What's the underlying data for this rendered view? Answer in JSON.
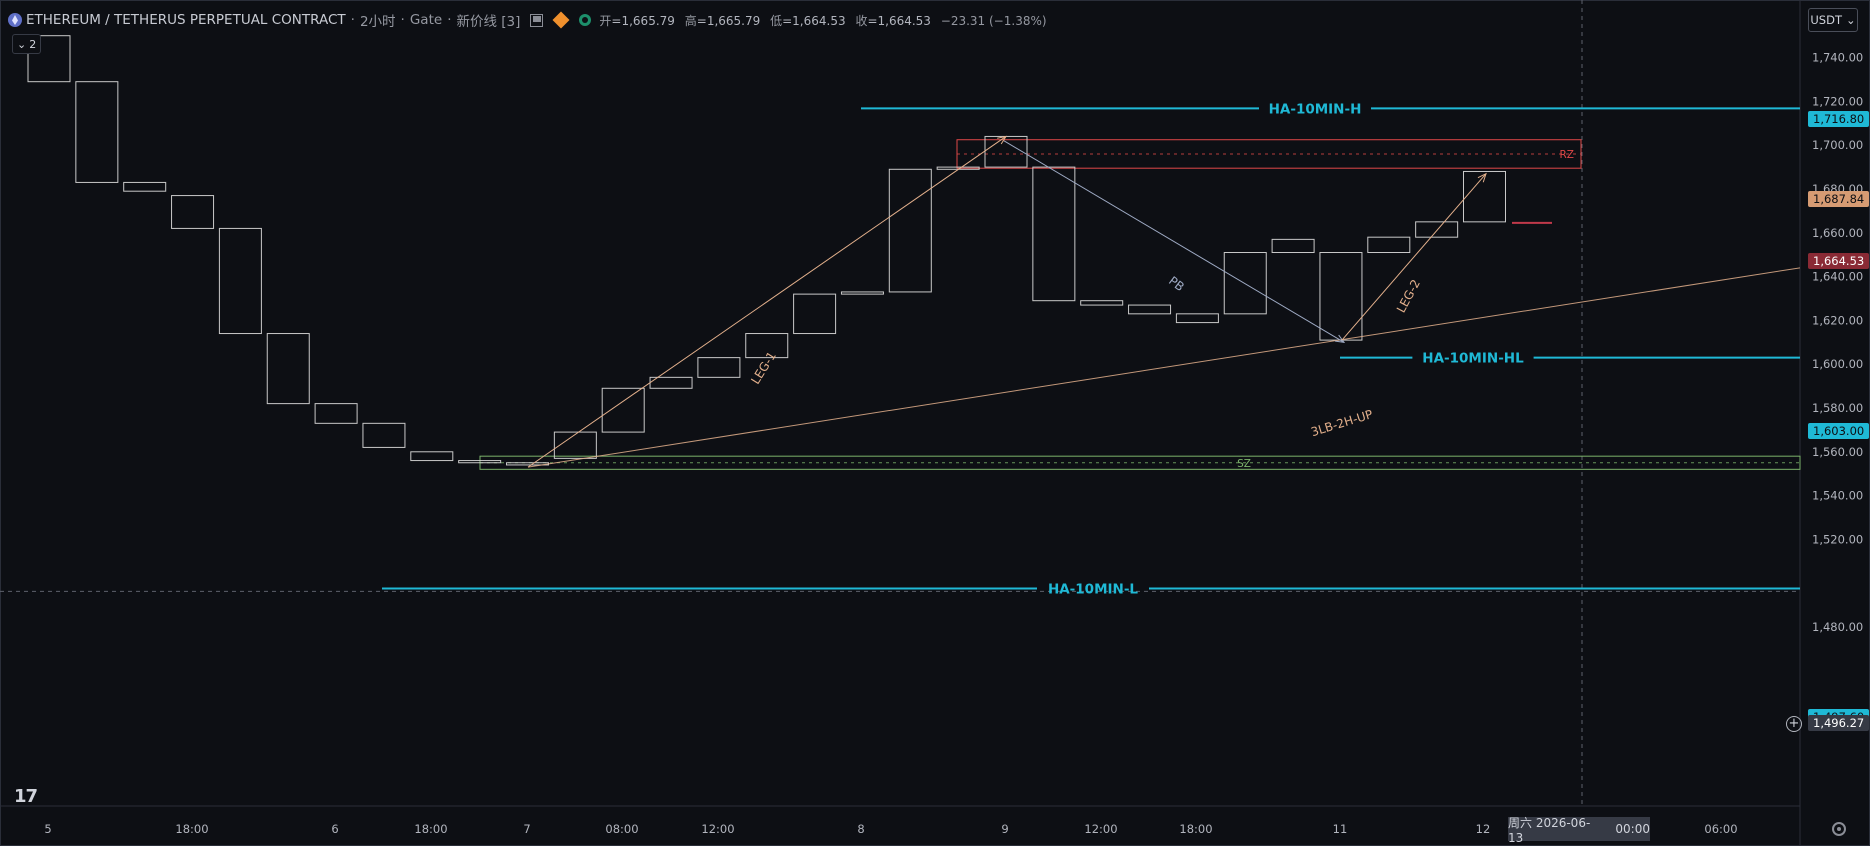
{
  "header": {
    "symbol": "ETHEREUM / TETHERUS PERPETUAL CONTRACT",
    "interval": "2小时",
    "exchange": "Gate",
    "style": "新价线 [3]",
    "open_label": "开",
    "open": "=1,665.79",
    "high_label": "高",
    "high": "=1,665.79",
    "low_label": "低",
    "low": "=1,664.53",
    "close_label": "收",
    "close": "=1,664.53",
    "change": "−23.31 (−1.38%)",
    "icons": [
      "ethereum-icon",
      "flag-icon",
      "diamond-icon",
      "market-status-icon"
    ]
  },
  "legend_button": {
    "label": "2"
  },
  "currency_button": {
    "label": "USDT"
  },
  "crosshair_datetime": {
    "date": "周六 2026-06-13",
    "time": "00:00"
  },
  "colors": {
    "background": "#0d0f14",
    "candle": "#d9d9d9",
    "leg_color": "#e3b08c",
    "pb_color": "#9eaac4",
    "ha_line": "#1fb9d6",
    "rz": "#e04848",
    "sz": "#7cb36b",
    "last_price_tag": "#8a2a35",
    "orange_tag": "#d69b73"
  },
  "chart_data": {
    "type": "line",
    "subtype": "renko_line_break",
    "ylim": [
      1465,
      1750
    ],
    "y_ticks": [
      "1,740.00",
      "1,720.00",
      "1,700.00",
      "1,680.00",
      "1,660.00",
      "1,640.00",
      "1,620.00",
      "1,600.00",
      "1,580.00",
      "1,560.00",
      "1,540.00",
      "1,520.00",
      "1,480.00"
    ],
    "x_ticks": [
      "5",
      "18:00",
      "6",
      "18:00",
      "7",
      "08:00",
      "12:00",
      "8",
      "9",
      "12:00",
      "18:00",
      "11",
      "12",
      "06:00"
    ],
    "bricks": [
      [
        1750,
        1729
      ],
      [
        1729,
        1683
      ],
      [
        1683,
        1679
      ],
      [
        1677,
        1662
      ],
      [
        1662,
        1614
      ],
      [
        1614,
        1582
      ],
      [
        1582,
        1573
      ],
      [
        1573,
        1562
      ],
      [
        1560,
        1556
      ],
      [
        1556,
        1555
      ],
      [
        1555,
        1554
      ],
      [
        1557,
        1569
      ],
      [
        1569,
        1589
      ],
      [
        1589,
        1594
      ],
      [
        1594,
        1603
      ],
      [
        1603,
        1614
      ],
      [
        1614,
        1632
      ],
      [
        1632,
        1633
      ],
      [
        1633,
        1689
      ],
      [
        1689,
        1690
      ],
      [
        1690,
        1704
      ],
      [
        1690,
        1629
      ],
      [
        1629,
        1627
      ],
      [
        1627,
        1623
      ],
      [
        1623,
        1619
      ],
      [
        1623,
        1651
      ],
      [
        1651,
        1657
      ],
      [
        1651,
        1611
      ],
      [
        1651,
        1658
      ],
      [
        1658,
        1665
      ],
      [
        1665,
        1688
      ]
    ],
    "levels": [
      {
        "name": "HA-10MIN-H",
        "value": 1716.8,
        "tag": "1,716.80"
      },
      {
        "name": "HA-10MIN-HL",
        "value": 1603.0,
        "tag": "1,603.00"
      },
      {
        "name": "HA-10MIN-L",
        "value": 1497.6,
        "tag": "1,497.60"
      }
    ],
    "zones": [
      {
        "name": "RZ",
        "top": 1702.5,
        "bottom": 1689.5
      },
      {
        "name": "SZ",
        "top": 1558,
        "bottom": 1552
      }
    ],
    "annotations": [
      "LEG-1",
      "PB",
      "LEG-2",
      "3LB-2H-UP"
    ],
    "price_tags": [
      {
        "label": "1,687.84",
        "value": 1687.84
      },
      {
        "label": "1,664.53",
        "value": 1664.53
      },
      {
        "label": "1,496.27",
        "value": 1496.27
      }
    ],
    "last_price": 1664.53,
    "crosshair_price": 1496.27
  }
}
